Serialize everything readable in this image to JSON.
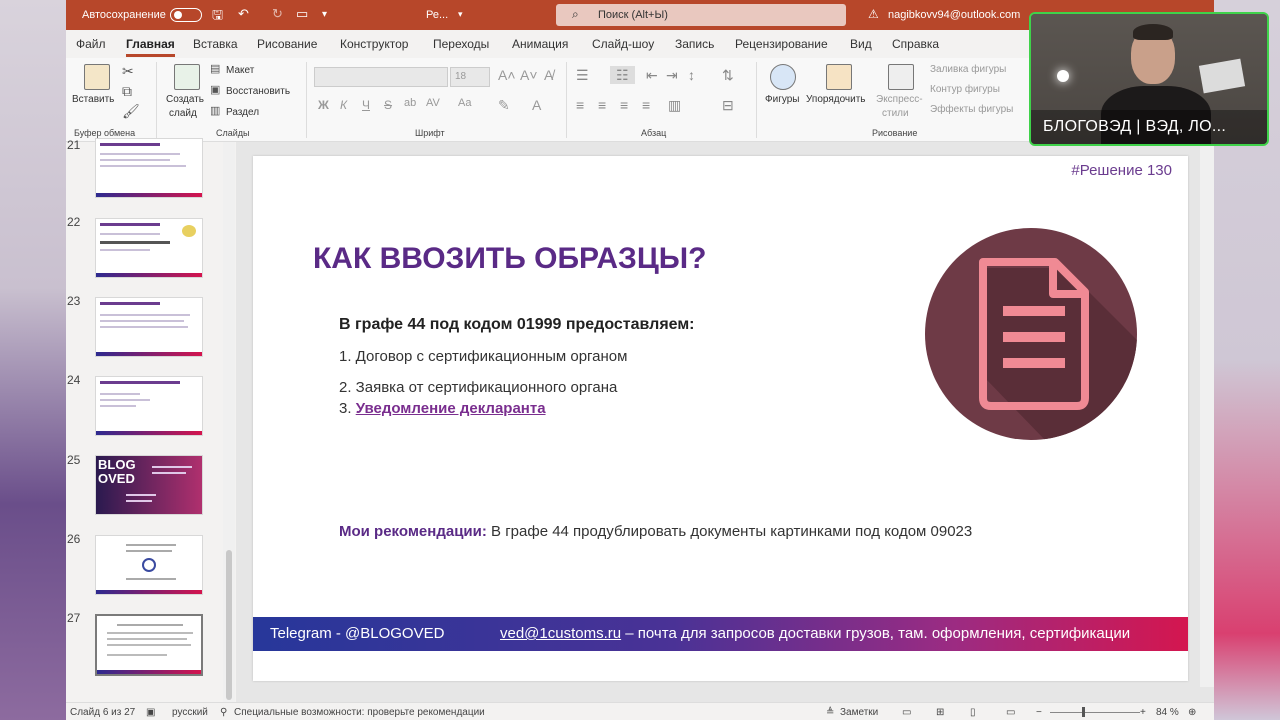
{
  "titlebar": {
    "autosave": "Автосохранение",
    "doc": "Ре...",
    "search_placeholder": "Поиск (Alt+Ы)",
    "account": "nagibkovv94@outlook.com"
  },
  "menu": [
    "Файл",
    "Главная",
    "Вставка",
    "Рисование",
    "Конструктор",
    "Переходы",
    "Анимация",
    "Слайд-шоу",
    "Запись",
    "Рецензирование",
    "Вид",
    "Справка"
  ],
  "ribbon": {
    "paste": "Вставить",
    "clipboard": "Буфер обмена",
    "new_slide_1": "Создать",
    "new_slide_2": "слайд",
    "layout": "Макет",
    "reset": "Восстановить",
    "section": "Раздел",
    "slides": "Слайды",
    "font_size": "18",
    "font": "Шрифт",
    "bold": "Ж",
    "italic": "К",
    "underline": "Ч",
    "strike": "S",
    "paragraph": "Абзац",
    "shapes": "Фигуры",
    "arrange": "Упорядочить",
    "express_1": "Экспресс-",
    "express_2": "стили",
    "drawing": "Рисование",
    "fill": "Заливка фигуры",
    "outline": "Контур фигуры",
    "effects": "Эффекты фигуры"
  },
  "thumbnails": [
    "21",
    "22",
    "23",
    "24",
    "25",
    "26",
    "27"
  ],
  "thumb25": {
    "line1": "BLOG",
    "line2": "OVED"
  },
  "slide": {
    "tag": "#Решение 130",
    "title": "КАК ВВОЗИТЬ ОБРАЗЦЫ?",
    "subtitle": "В графе 44 под кодом 01999 предоставляем:",
    "item1": "1. Договор с сертификационным органом",
    "item2": "2. Заявка от сертификационного органа",
    "item3_num": "3. ",
    "item3_link": "Уведомление декларанта",
    "reco_label": "Мои рекомендации:",
    "reco_text": " В графе 44 продублировать документы картинками под кодом 09023",
    "footer_left": "Telegram - @BLOGOVED",
    "footer_email": "ved@1customs.ru",
    "footer_rest": " – почта для запросов доставки грузов, там. оформления, сертификации",
    "colors": {
      "title": "#5a2a86",
      "circle": "#6e3a46",
      "doc_icon": "#f08a94"
    }
  },
  "status": {
    "slide_of": "Слайд 6 из 27",
    "lang": "русский",
    "accessibility": "Специальные возможности: проверьте рекомендации",
    "notes": "Заметки",
    "zoom": "84 %"
  },
  "webcam": {
    "name": "БЛОГОВЭД | ВЭД, ЛО..."
  }
}
